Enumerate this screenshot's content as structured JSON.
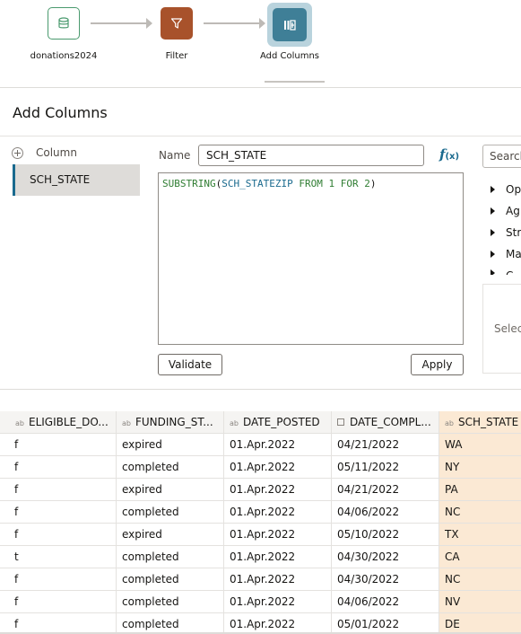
{
  "pipeline": {
    "steps": [
      {
        "label": "donations2024",
        "icon": "database-icon"
      },
      {
        "label": "Filter",
        "icon": "filter-icon"
      },
      {
        "label": "Add Columns",
        "icon": "add-columns-icon"
      }
    ]
  },
  "page_title": "Add Columns",
  "columns_panel": {
    "header": "Column",
    "items": [
      "SCH_STATE"
    ]
  },
  "editor": {
    "name_label": "Name",
    "name_value": "SCH_STATE",
    "fx_label": "f",
    "fx_sub": "(x)",
    "expression": {
      "fn": "SUBSTRING",
      "open": "(",
      "column": "SCH_STATEZIP",
      "from_kw": "FROM",
      "from_val": "1",
      "for_kw": "FOR",
      "for_val": "2",
      "close": ")"
    },
    "validate_label": "Validate",
    "apply_label": "Apply"
  },
  "functions_panel": {
    "search_placeholder": "Search",
    "categories": [
      "Op",
      "Ag",
      "Str",
      "Ma",
      "C"
    ],
    "helper_text": "Select"
  },
  "grid": {
    "columns": [
      {
        "name": "ELIGIBLE_DO...",
        "type": "ab"
      },
      {
        "name": "FUNDING_ST...",
        "type": "ab"
      },
      {
        "name": "DATE_POSTED",
        "type": "ab"
      },
      {
        "name": "DATE_COMPL...",
        "type": "date"
      },
      {
        "name": "SCH_STATE",
        "type": "ab"
      }
    ],
    "rows": [
      [
        "f",
        "expired",
        "01.Apr.2022",
        "04/21/2022",
        "WA"
      ],
      [
        "f",
        "completed",
        "01.Apr.2022",
        "05/11/2022",
        "NY"
      ],
      [
        "f",
        "expired",
        "01.Apr.2022",
        "04/21/2022",
        "PA"
      ],
      [
        "f",
        "completed",
        "01.Apr.2022",
        "04/06/2022",
        "NC"
      ],
      [
        "f",
        "expired",
        "01.Apr.2022",
        "05/10/2022",
        "TX"
      ],
      [
        "t",
        "completed",
        "01.Apr.2022",
        "04/30/2022",
        "CA"
      ],
      [
        "f",
        "completed",
        "01.Apr.2022",
        "04/30/2022",
        "NC"
      ],
      [
        "f",
        "completed",
        "01.Apr.2022",
        "04/06/2022",
        "NV"
      ],
      [
        "f",
        "completed",
        "01.Apr.2022",
        "05/01/2022",
        "DE"
      ]
    ]
  },
  "colors": {
    "source_node": "#4a9a6e",
    "filter_node": "#a8522b",
    "active_node": "#3f7f97",
    "accent": "#1a6a8e",
    "highlight_column": "#fbe9d4"
  }
}
